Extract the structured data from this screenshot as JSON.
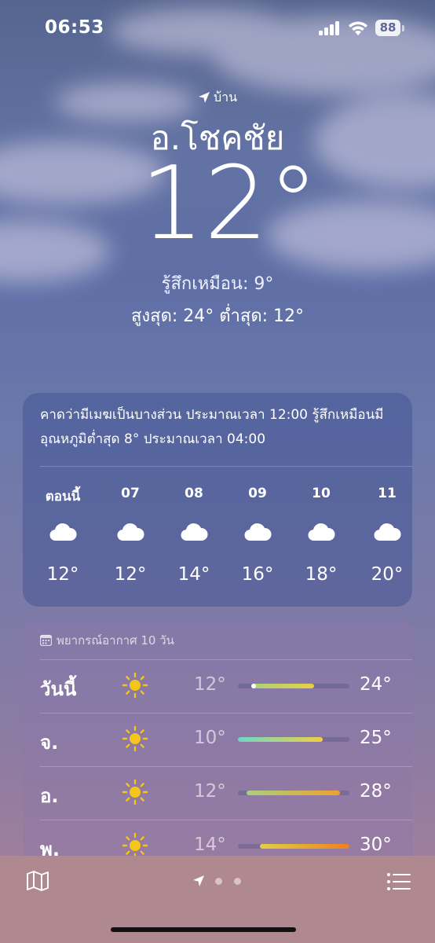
{
  "status": {
    "time": "06:53",
    "battery": "88"
  },
  "location": {
    "label": "บ้าน",
    "city": "อ.โชคชัย"
  },
  "current": {
    "temp": "12°",
    "feels_like": "รู้สึกเหมือน: 9°",
    "high_low": "สูงสุด: 24°  ต่ำสุด: 12°"
  },
  "hourly": {
    "summary": "คาดว่ามีเมฆเป็นบางส่วน ประมาณเวลา 12:00 รู้สึกเหมือนมีอุณหภูมิต่ำสุด 8° ประมาณเวลา 04:00",
    "items": [
      {
        "label": "ตอนนี้",
        "icon": "cloud-icon",
        "temp": "12°"
      },
      {
        "label": "07",
        "icon": "cloud-icon",
        "temp": "12°"
      },
      {
        "label": "08",
        "icon": "cloud-icon",
        "temp": "14°"
      },
      {
        "label": "09",
        "icon": "cloud-icon",
        "temp": "16°"
      },
      {
        "label": "10",
        "icon": "cloud-icon",
        "temp": "18°"
      },
      {
        "label": "11",
        "icon": "cloud-icon",
        "temp": "20°"
      }
    ]
  },
  "daily": {
    "title": "พยากรณ์อากาศ 10 วัน",
    "days": [
      {
        "day": "วันนี้",
        "icon": "sun-icon",
        "low": "12°",
        "high": "24°",
        "bar_start": 0.12,
        "bar_end": 0.68,
        "current": 0.12,
        "colors": [
          "#a8d080",
          "#e8d040"
        ]
      },
      {
        "day": "จ.",
        "icon": "sun-icon",
        "low": "10°",
        "high": "25°",
        "bar_start": 0.0,
        "bar_end": 0.76,
        "colors": [
          "#6fd6c8",
          "#f0d040"
        ]
      },
      {
        "day": "อ.",
        "icon": "sun-icon",
        "low": "12°",
        "high": "28°",
        "bar_start": 0.08,
        "bar_end": 0.92,
        "colors": [
          "#a8d080",
          "#f0a030"
        ]
      },
      {
        "day": "พ.",
        "icon": "sun-icon",
        "low": "14°",
        "high": "30°",
        "bar_start": 0.2,
        "bar_end": 1.0,
        "colors": [
          "#e0d040",
          "#f08020"
        ]
      }
    ]
  },
  "toolbar": {
    "map": "map-icon",
    "location": "location-arrow-icon",
    "list": "list-icon"
  }
}
